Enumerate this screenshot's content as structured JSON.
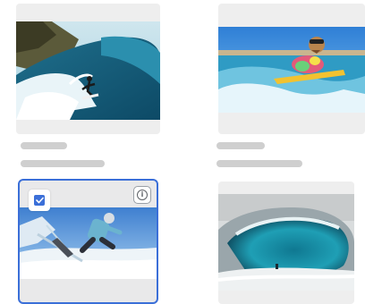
{
  "gallery": {
    "items": [
      {
        "id": "surfer-barrel",
        "selected": false,
        "icon": "photo-surfer-in-wave"
      },
      {
        "id": "dog-surfing",
        "selected": false,
        "icon": "photo-dog-on-surfboard"
      },
      {
        "id": "snowboarder",
        "selected": true,
        "icon": "photo-snowboarder-jump"
      },
      {
        "id": "wave-curl",
        "selected": false,
        "icon": "photo-large-wave"
      }
    ],
    "info_icon_glyph": "i",
    "colors": {
      "selection": "#3b6fd8",
      "placeholder": "#cfcfcf",
      "card_bg": "#eeeeee"
    }
  }
}
